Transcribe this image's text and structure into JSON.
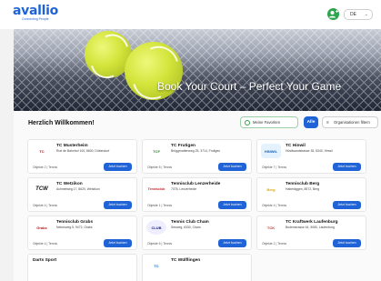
{
  "header": {
    "logo_text": "avallio",
    "logo_subtitle": "Connecting People",
    "language": "DE",
    "avatar_icon": "user-add-icon"
  },
  "hero": {
    "title": "Book Your Court – Perfect Your Game"
  },
  "main": {
    "welcome": "Herzlich Willkommen!",
    "favorites_label": "Meine Favoriten",
    "all_label": "Alle",
    "filter_label": "Organisationen filtern"
  },
  "clubs": [
    {
      "name": "TC Musterheim",
      "address": "Rue de Bahnhof 100, 8600, Dübendorf",
      "info": "Objekte 2 | Tennis",
      "button": "Jetzt buchen",
      "logo": "TC"
    },
    {
      "name": "TC Frutigen",
      "address": "Brüggmattenweg 25, 3714, Frutigen",
      "info": "Objekte 5 | Tennis",
      "button": "Jetzt buchen",
      "logo": "TCF"
    },
    {
      "name": "TC Hinwil",
      "address": "Hüsliwandstrasse 35, 8340, Hinwil",
      "info": "Objekte 7 | Tennis",
      "button": "Jetzt buchen",
      "logo": "HINWIL"
    },
    {
      "name": "TC Wetzikon",
      "address": "Achmetweg 17, 8620, Wetzikon",
      "info": "Objekte 4 | Tennis",
      "button": "Jetzt buchen",
      "logo": "TCW"
    },
    {
      "name": "Tennisclub Lenzerheide",
      "address": "7078, Lenzerheide",
      "info": "Objekte 1 | Tennis",
      "button": "Jetzt buchen",
      "logo": "Tennisclub"
    },
    {
      "name": "Tennisclub Berg",
      "address": "Haberäggen, 8572, Berg",
      "info": "Objekte 4 | Tennis",
      "button": "Jetzt buchen",
      "logo": "Berg"
    },
    {
      "name": "Tennisclub Grabs",
      "address": "Nebenweg 5, 9472, Grabs",
      "info": "Objekte 4 | Tennis",
      "button": "Jetzt buchen",
      "logo": "Grabs"
    },
    {
      "name": "Tennis Club Cham",
      "address": "Seeweg, 6330, Cham",
      "info": "Objekte 6 | Tennis",
      "button": "Jetzt buchen",
      "logo": "CLUB"
    },
    {
      "name": "TC Kraftwerk Laufenburg",
      "address": "Bodenstrasse 44, 5080, Laufenburg",
      "info": "Objekte 2 | Tennis",
      "button": "Jetzt buchen",
      "logo": "TCK"
    },
    {
      "name": "Darts Sport",
      "address": "",
      "info": "",
      "button": "",
      "logo": ""
    },
    {
      "name": "TC Wülflingen",
      "address": "",
      "info": "",
      "button": "",
      "logo": "TC"
    }
  ]
}
